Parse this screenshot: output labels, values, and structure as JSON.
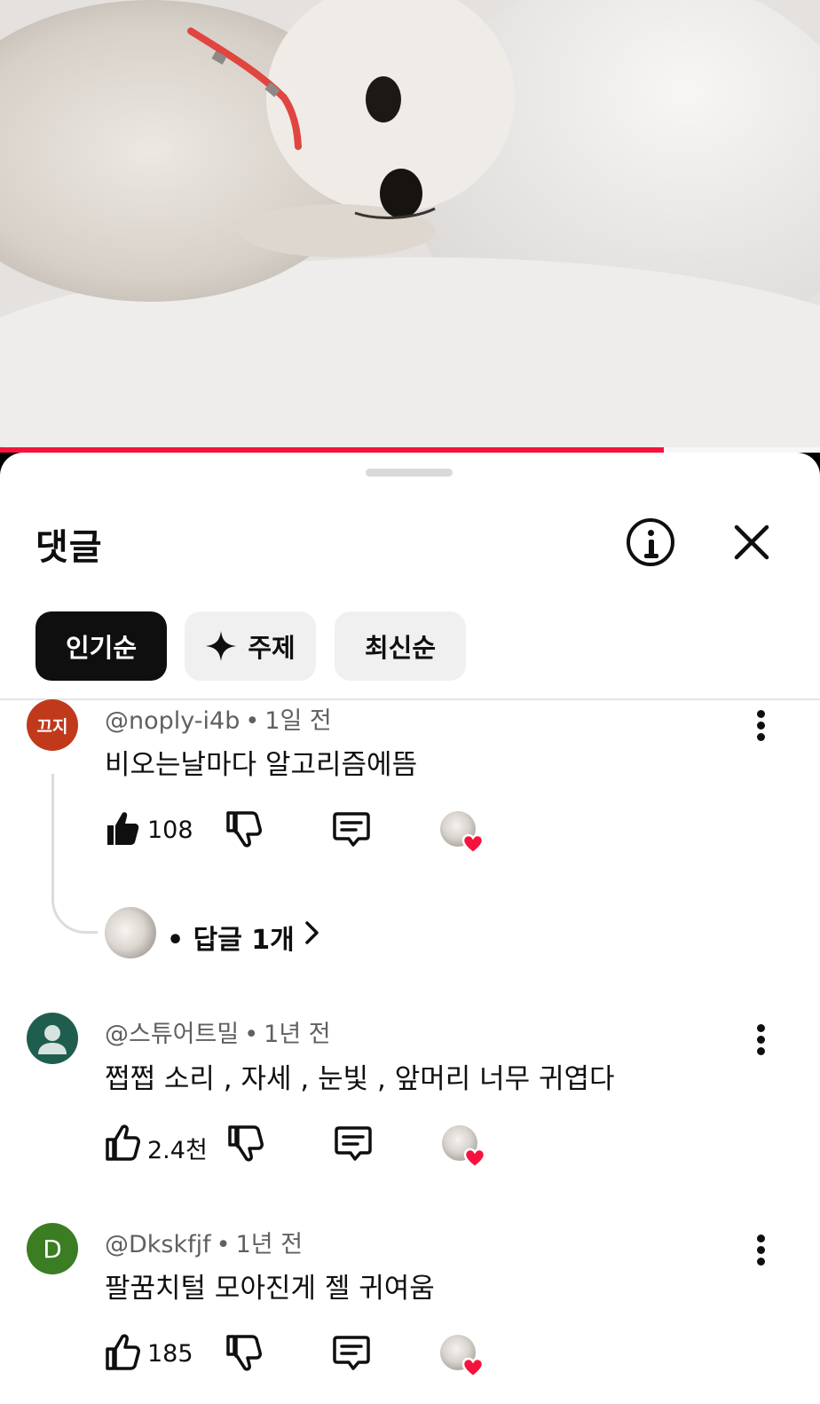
{
  "video": {
    "progress_fraction": 0.81,
    "accent_color": "#f5133e"
  },
  "panel": {
    "title": "댓글",
    "info_icon": "info-icon",
    "close_icon": "close-icon"
  },
  "filters": {
    "top": "인기순",
    "topics": "주제",
    "topics_icon": "sparkle-icon",
    "newest": "최신순"
  },
  "comments": [
    {
      "avatar_text": "끄지",
      "avatar_color": "#c1391b",
      "author": "@noply-i4b",
      "time": "1일 전",
      "text": "비오는날마다 알고리즘에뜸",
      "likes": "108",
      "liked": true,
      "replies": "답글 1개"
    },
    {
      "avatar_text": "",
      "avatar_color": "#1f5e4e",
      "author": "@스튜어트밀",
      "time": "1년 전",
      "text": "쩝쩝 소리 , 자세 , 눈빛 , 앞머리 너무 귀엽다",
      "likes": "2.4천",
      "liked": false
    },
    {
      "avatar_text": "D",
      "avatar_color": "#3a7d22",
      "author": "@Dkskfjf",
      "time": "1년 전",
      "text": "팔꿈치털 모아진게 젤 귀여움",
      "likes": "185",
      "liked": false
    }
  ],
  "separator": "•"
}
